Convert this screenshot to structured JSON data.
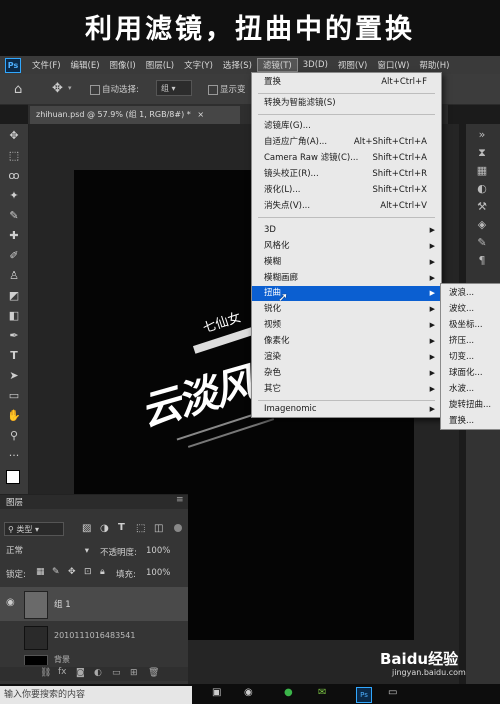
{
  "caption": "利用滤镜，扭曲中的置换",
  "menubar": {
    "logo": "Ps",
    "items": [
      "文件(F)",
      "编辑(E)",
      "图像(I)",
      "图层(L)",
      "文字(Y)",
      "选择(S)",
      "滤镜(T)",
      "3D(D)",
      "视图(V)",
      "窗口(W)",
      "帮助(H)"
    ],
    "active_index": 6
  },
  "options": {
    "auto_select_label": "自动选择:",
    "auto_select_value": "组",
    "show_transform_label": "显示变"
  },
  "doc_tab": "zhihuan.psd @ 57.9% (组 1, RGB/8#) *",
  "filter_menu": {
    "items": [
      {
        "label": "置换",
        "shortcut": "Alt+Ctrl+F"
      },
      {
        "label": "转换为智能滤镜(S)",
        "shortcut": ""
      },
      {
        "label": "滤镜库(G)...",
        "shortcut": ""
      },
      {
        "label": "自适应广角(A)...",
        "shortcut": "Alt+Shift+Ctrl+A"
      },
      {
        "label": "Camera Raw 滤镜(C)...",
        "shortcut": "Shift+Ctrl+A"
      },
      {
        "label": "镜头校正(R)...",
        "shortcut": "Shift+Ctrl+R"
      },
      {
        "label": "液化(L)...",
        "shortcut": "Shift+Ctrl+X"
      },
      {
        "label": "消失点(V)...",
        "shortcut": "Alt+Ctrl+V"
      },
      {
        "label": "3D",
        "shortcut": ""
      },
      {
        "label": "风格化",
        "shortcut": ""
      },
      {
        "label": "模糊",
        "shortcut": ""
      },
      {
        "label": "模糊画廊",
        "shortcut": ""
      },
      {
        "label": "扭曲",
        "shortcut": ""
      },
      {
        "label": "锐化",
        "shortcut": ""
      },
      {
        "label": "视频",
        "shortcut": ""
      },
      {
        "label": "像素化",
        "shortcut": ""
      },
      {
        "label": "渲染",
        "shortcut": ""
      },
      {
        "label": "杂色",
        "shortcut": ""
      },
      {
        "label": "其它",
        "shortcut": ""
      },
      {
        "label": "Imagenomic",
        "shortcut": ""
      }
    ],
    "highlighted": "扭曲"
  },
  "submenu": [
    "波浪...",
    "波纹...",
    "极坐标...",
    "挤压...",
    "切变...",
    "球面化...",
    "水波...",
    "旋转扭曲...",
    "置换..."
  ],
  "canvas_text": {
    "main": "云淡风轻",
    "small": "七仙女"
  },
  "layers": {
    "tab": "图层",
    "kind_label": "类型",
    "blend_mode": "正常",
    "opacity_label": "不透明度:",
    "opacity_value": "100%",
    "lock_label": "锁定:",
    "fill_label": "填充:",
    "fill_value": "100%",
    "rows": [
      "组 1",
      "2010111016483541",
      "背景"
    ]
  },
  "taskbar": {
    "search_placeholder": "输入你要搜索的内容"
  },
  "watermark": {
    "brand": "Baidu经验",
    "url": "jingyan.baidu.com"
  }
}
